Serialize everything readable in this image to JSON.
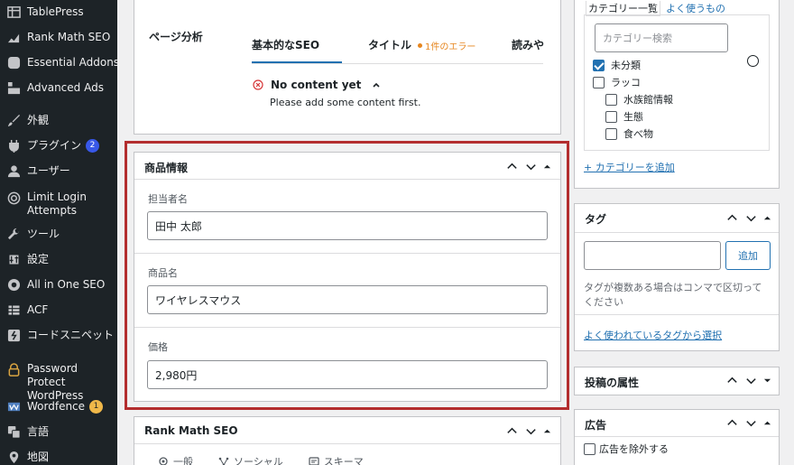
{
  "sidebar": {
    "items": [
      {
        "label": "TablePress",
        "icon": "table-icon"
      },
      {
        "label": "Rank Math SEO",
        "icon": "rankmath-icon"
      },
      {
        "label": "Essential Addons",
        "icon": "ea-icon"
      },
      {
        "label": "Advanced Ads",
        "icon": "ads-icon"
      },
      {
        "label": "外観",
        "icon": "brush-icon"
      },
      {
        "label": "プラグイン",
        "icon": "plugin-icon",
        "badge": "2"
      },
      {
        "label": "ユーザー",
        "icon": "user-icon"
      },
      {
        "label": "Limit Login Attempts",
        "icon": "fingerprint-icon"
      },
      {
        "label": "ツール",
        "icon": "wrench-icon"
      },
      {
        "label": "設定",
        "icon": "settings-icon"
      },
      {
        "label": "All in One SEO",
        "icon": "aioseo-icon"
      },
      {
        "label": "ACF",
        "icon": "acf-icon"
      },
      {
        "label": "コードスニペット",
        "icon": "snippet-icon"
      },
      {
        "label": "Password Protect WordPress",
        "icon": "lock-icon"
      },
      {
        "label": "Wordfence",
        "icon": "wordfence-icon",
        "badge": "1"
      },
      {
        "label": "言語",
        "icon": "translate-icon"
      },
      {
        "label": "地図",
        "icon": "map-pin-icon"
      }
    ]
  },
  "seo": {
    "section_label": "ページ分析",
    "tabs": [
      "基本的なSEO",
      "タイトル",
      "読みや"
    ],
    "error_badge": "1件のエラー",
    "status_title": "No content yet",
    "status_text": "Please add some content first."
  },
  "product": {
    "title": "商品情報",
    "fields": [
      {
        "label": "担当者名",
        "value": "田中 太郎"
      },
      {
        "label": "商品名",
        "value": "ワイヤレスマウス"
      },
      {
        "label": "価格",
        "value": "2,980円"
      }
    ]
  },
  "rankmath": {
    "title": "Rank Math SEO",
    "tabs": [
      "一般",
      "ソーシャル",
      "スキーマ"
    ]
  },
  "categories": {
    "tabs": [
      "カテゴリー一覧",
      "よく使うもの"
    ],
    "search_placeholder": "カテゴリー検索",
    "items": [
      {
        "label": "未分類",
        "checked": true
      },
      {
        "label": "ラッコ",
        "checked": false
      },
      {
        "label": "水族館情報",
        "checked": false
      },
      {
        "label": "生態",
        "checked": false
      },
      {
        "label": "食べ物",
        "checked": false
      }
    ],
    "add_link": "+ カテゴリーを追加"
  },
  "tags": {
    "title": "タグ",
    "add_button": "追加",
    "help": "タグが複数ある場合はコンマで区切ってください",
    "popular_link": "よく使われているタグから選択"
  },
  "attributes": {
    "title": "投稿の属性"
  },
  "ads": {
    "title": "広告",
    "exclude_label": "広告を除外する"
  },
  "colors": {
    "accent": "#2271b1",
    "highlight": "#b32d2e",
    "sidebar": "#1d2327"
  }
}
